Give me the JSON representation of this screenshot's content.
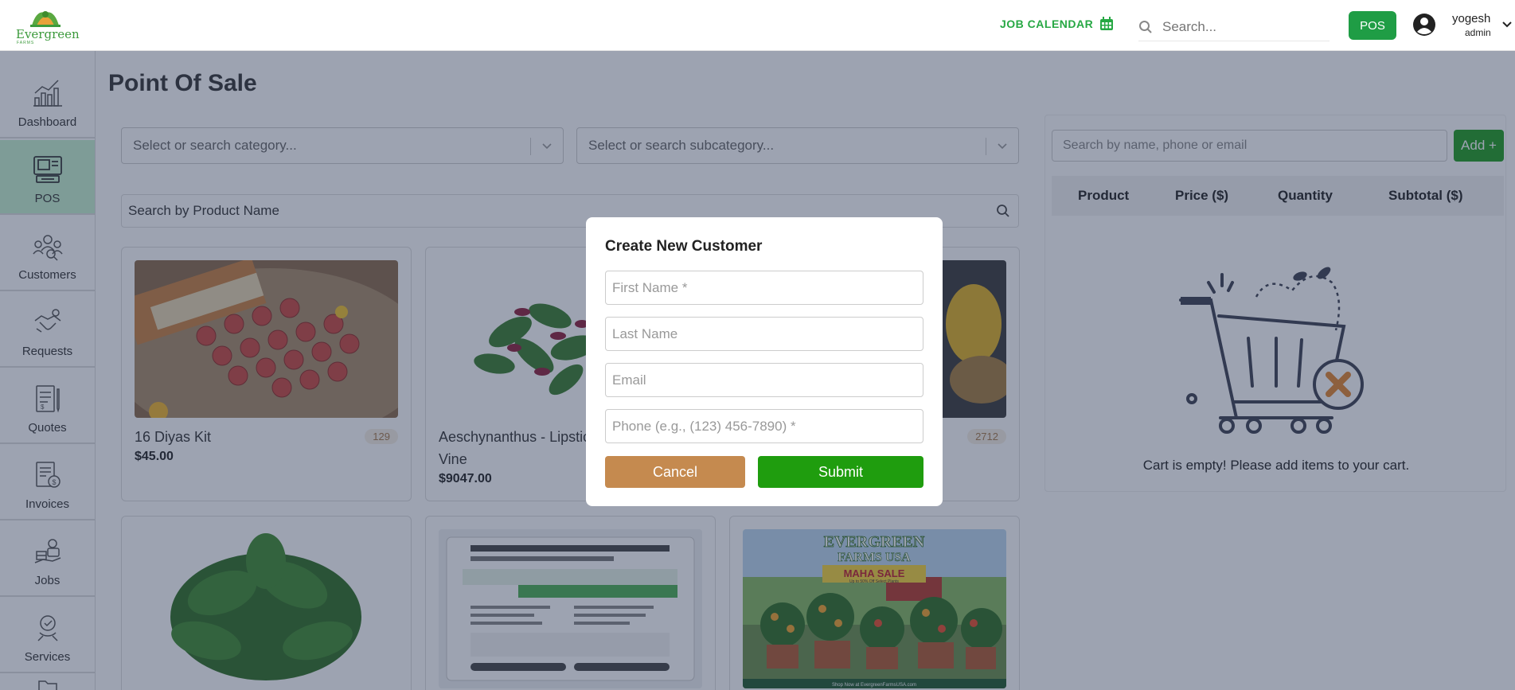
{
  "header": {
    "logo_text": "Evergreen",
    "logo_subtext": "FARMS",
    "job_calendar_label": "JOB CALENDAR",
    "search_placeholder": "Search...",
    "pos_button": "POS",
    "user_name": "yogesh",
    "user_role": "admin"
  },
  "sidebar": {
    "items": [
      {
        "label": "Dashboard",
        "icon": "bar-chart-icon",
        "active": false
      },
      {
        "label": "POS",
        "icon": "pos-terminal-icon",
        "active": true
      },
      {
        "label": "Customers",
        "icon": "customers-icon",
        "active": false
      },
      {
        "label": "Requests",
        "icon": "handshake-icon",
        "active": false
      },
      {
        "label": "Quotes",
        "icon": "quote-document-icon",
        "active": false
      },
      {
        "label": "Invoices",
        "icon": "invoice-icon",
        "active": false
      },
      {
        "label": "Jobs",
        "icon": "jobs-icon",
        "active": false
      },
      {
        "label": "Services",
        "icon": "services-icon",
        "active": false
      }
    ]
  },
  "main": {
    "title": "Point Of Sale",
    "category_placeholder": "Select or search category...",
    "subcategory_placeholder": "Select or search subcategory...",
    "product_search_placeholder": "Search by Product Name",
    "products": [
      {
        "name": "16 Diyas Kit",
        "price": "$45.00",
        "stock": "129"
      },
      {
        "name": "Aeschynanthus - Lipstick Vine",
        "price": "$9047.00",
        "stock": ""
      },
      {
        "name": "",
        "price": "",
        "stock": "2712"
      }
    ],
    "banner": {
      "line1": "EVERGREEN",
      "line2": "FARMS USA",
      "sale": "MAHA SALE",
      "sale_sub": "Up to 50% Off Select Plants",
      "footer": "Shop Now at EvergreenFarmsUSA.com"
    }
  },
  "cart": {
    "customer_search_placeholder": "Search by name, phone or email",
    "add_button": "Add +",
    "columns": [
      "Product",
      "Price ($)",
      "Quantity",
      "Subtotal ($)"
    ],
    "empty_message": "Cart is empty! Please add items to your cart."
  },
  "modal": {
    "title": "Create New Customer",
    "first_name_placeholder": "First Name *",
    "last_name_placeholder": "Last Name",
    "email_placeholder": "Email",
    "phone_placeholder": "Phone (e.g., (123) 456-7890) *",
    "cancel_label": "Cancel",
    "submit_label": "Submit"
  },
  "colors": {
    "brand_green": "#1f9d45",
    "submit_green": "#1f9d0e",
    "cancel_brown": "#c58a4f",
    "active_nav": "#c6f3cf"
  }
}
